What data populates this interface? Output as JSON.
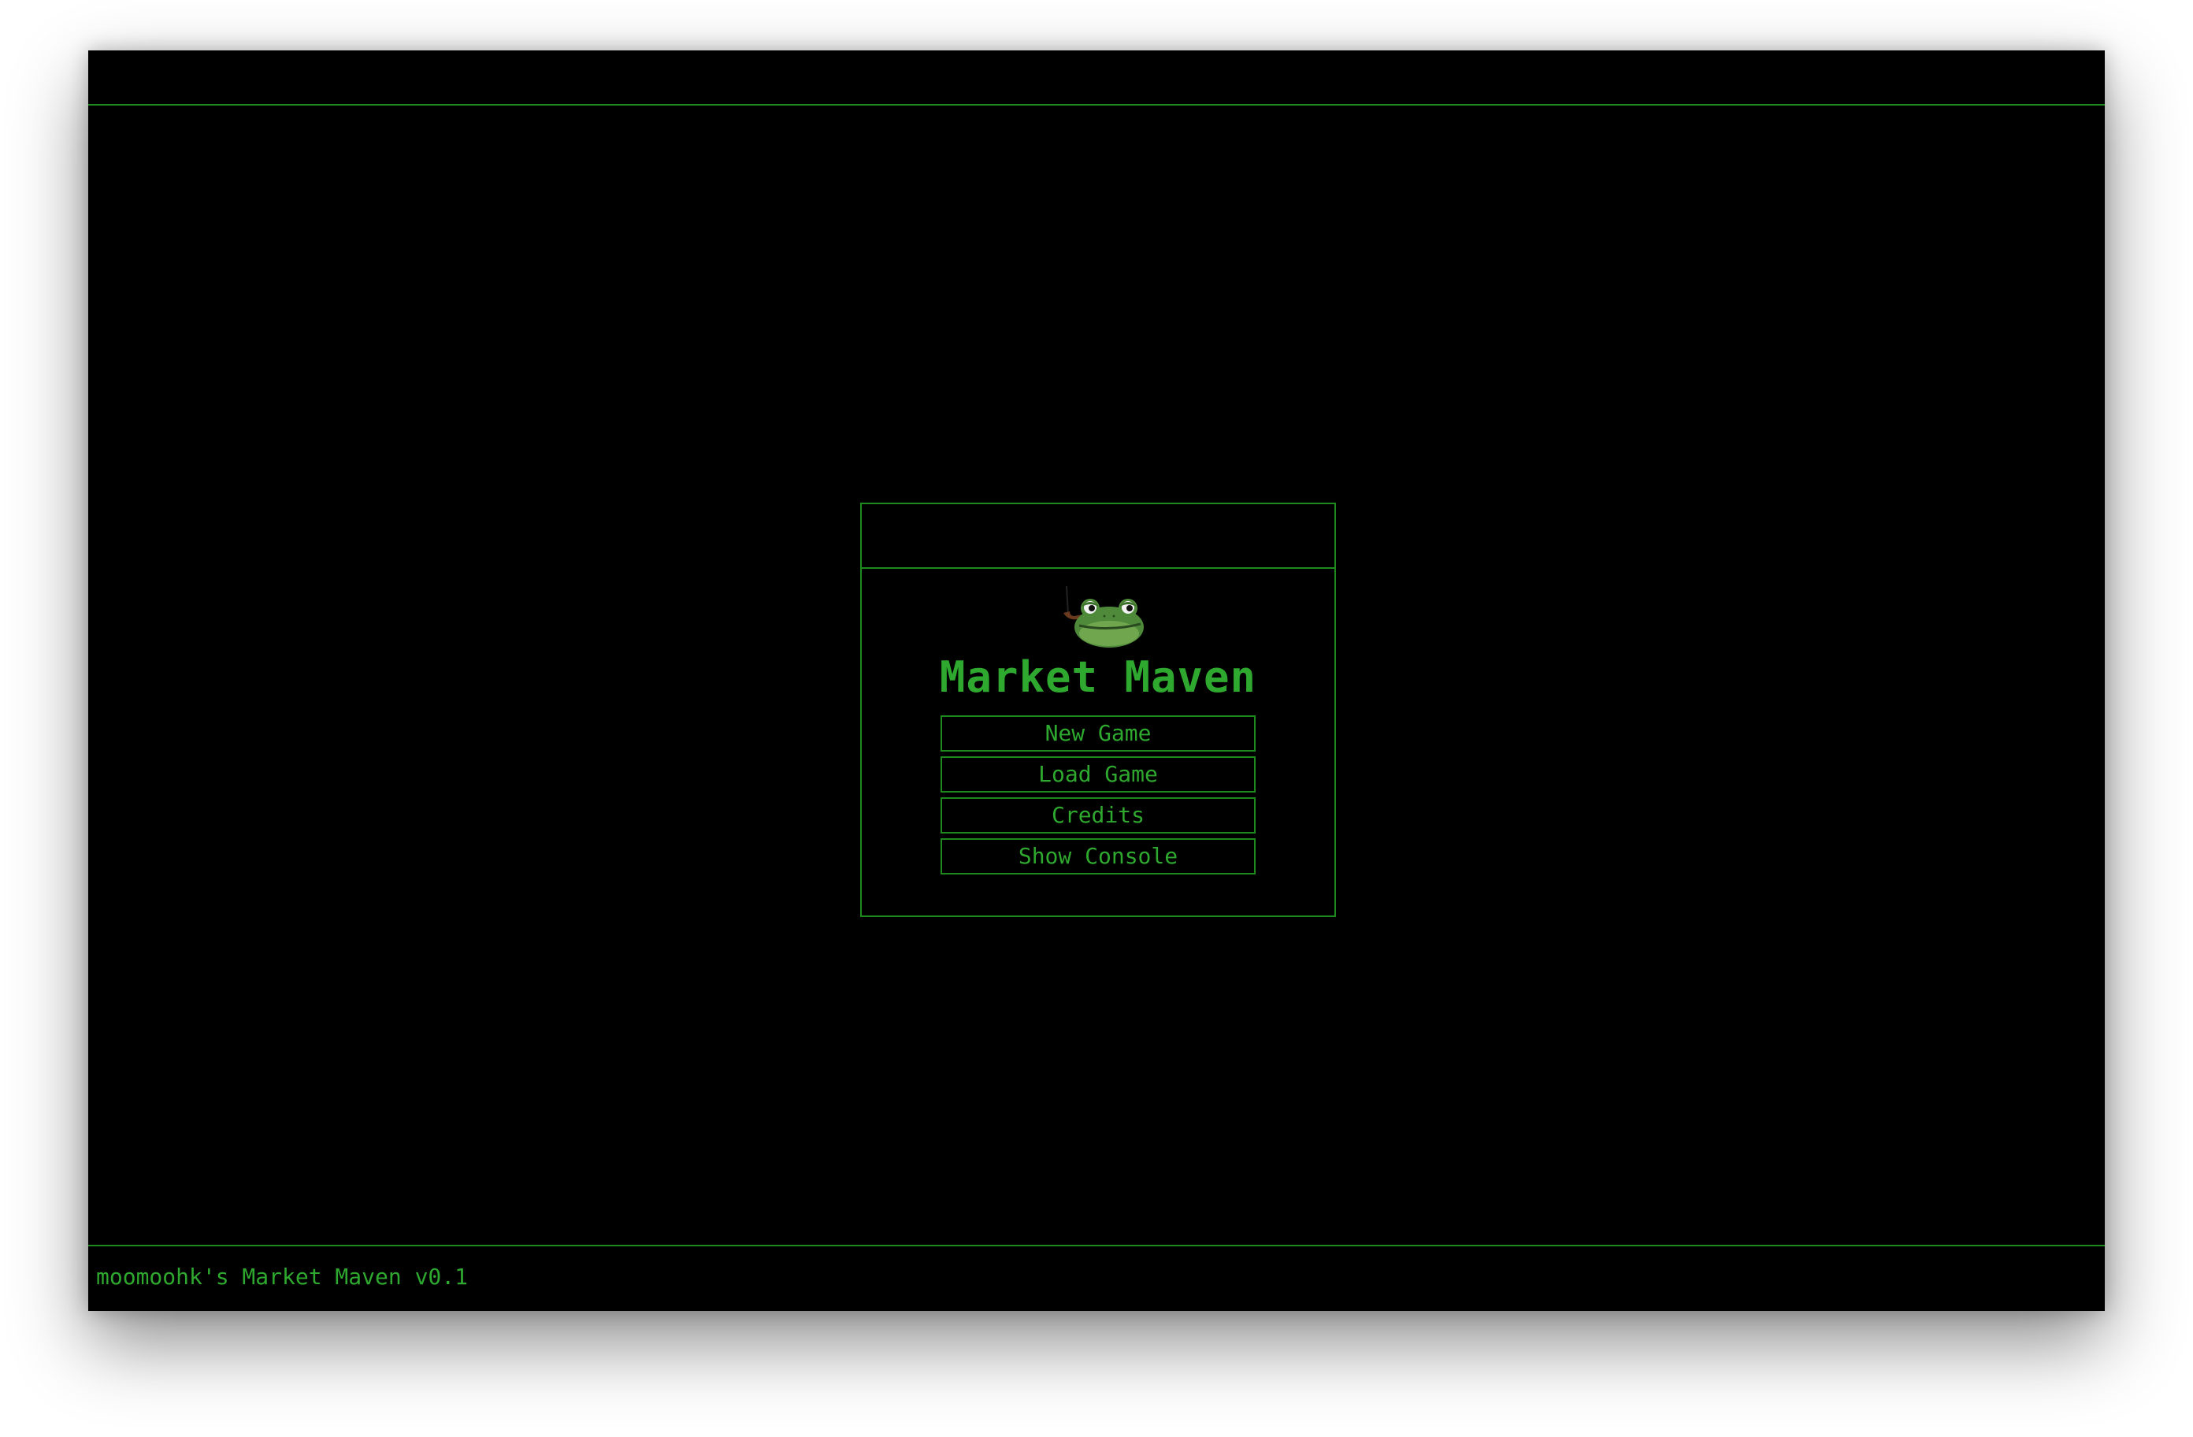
{
  "app": {
    "title": "Market Maven",
    "logo_icon": "frog-smoking-pipe-icon"
  },
  "menu": {
    "buttons": [
      {
        "label": "New Game"
      },
      {
        "label": "Load Game"
      },
      {
        "label": "Credits"
      },
      {
        "label": "Show Console"
      }
    ]
  },
  "status_bar": {
    "text": "moomoohk's Market Maven v0.1"
  },
  "colors": {
    "background": "#000000",
    "accent": "#2ea82e",
    "border": "#1e8a1e"
  }
}
